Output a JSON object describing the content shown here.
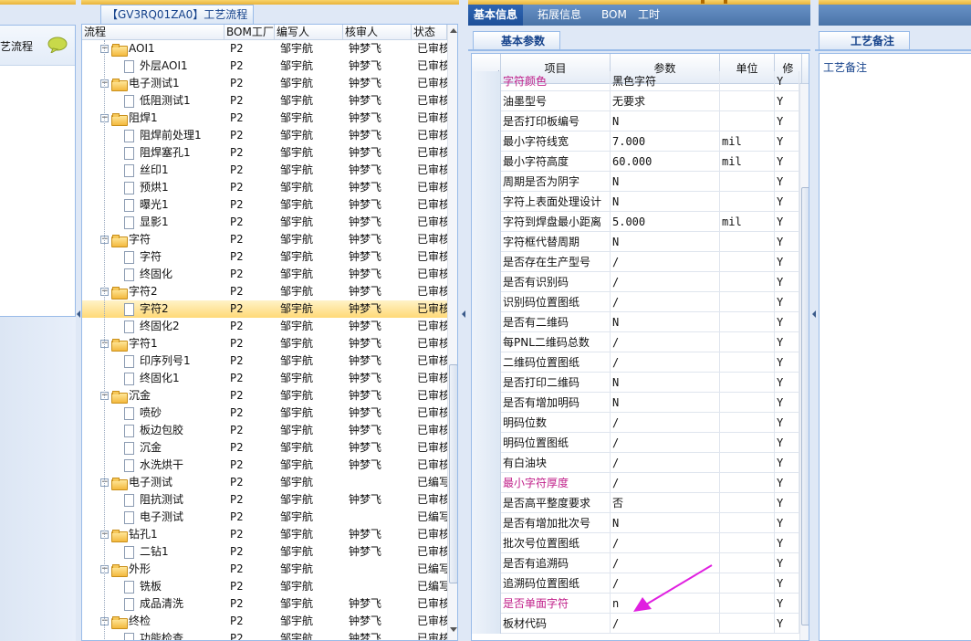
{
  "left_panel": {
    "label": "艺流程",
    "icon": "speech-bubble-icon"
  },
  "flow": {
    "title": "【GV3RQ01ZA0】工艺流程",
    "columns": [
      "流程",
      "BOM工厂",
      "编写人",
      "核审人",
      "状态"
    ],
    "rows": [
      {
        "name": "AOI1",
        "factory": "P2",
        "writer": "邹宇航",
        "reviewer": "钟梦飞",
        "status": "已审核"
      },
      {
        "name": "外层AOI1",
        "factory": "P2",
        "writer": "邹宇航",
        "reviewer": "钟梦飞",
        "status": "已审核"
      },
      {
        "name": "电子测试1",
        "factory": "P2",
        "writer": "邹宇航",
        "reviewer": "钟梦飞",
        "status": "已审核"
      },
      {
        "name": "低阻测试1",
        "factory": "P2",
        "writer": "邹宇航",
        "reviewer": "钟梦飞",
        "status": "已审核"
      },
      {
        "name": "阻焊1",
        "factory": "P2",
        "writer": "邹宇航",
        "reviewer": "钟梦飞",
        "status": "已审核"
      },
      {
        "name": "阻焊前处理1",
        "factory": "P2",
        "writer": "邹宇航",
        "reviewer": "钟梦飞",
        "status": "已审核"
      },
      {
        "name": "阻焊塞孔1",
        "factory": "P2",
        "writer": "邹宇航",
        "reviewer": "钟梦飞",
        "status": "已审核"
      },
      {
        "name": "丝印1",
        "factory": "P2",
        "writer": "邹宇航",
        "reviewer": "钟梦飞",
        "status": "已审核"
      },
      {
        "name": "预烘1",
        "factory": "P2",
        "writer": "邹宇航",
        "reviewer": "钟梦飞",
        "status": "已审核"
      },
      {
        "name": "曝光1",
        "factory": "P2",
        "writer": "邹宇航",
        "reviewer": "钟梦飞",
        "status": "已审核"
      },
      {
        "name": "显影1",
        "factory": "P2",
        "writer": "邹宇航",
        "reviewer": "钟梦飞",
        "status": "已审核"
      },
      {
        "name": "字符",
        "factory": "P2",
        "writer": "邹宇航",
        "reviewer": "钟梦飞",
        "status": "已审核"
      },
      {
        "name": "字符",
        "factory": "P2",
        "writer": "邹宇航",
        "reviewer": "钟梦飞",
        "status": "已审核"
      },
      {
        "name": "终固化",
        "factory": "P2",
        "writer": "邹宇航",
        "reviewer": "钟梦飞",
        "status": "已审核"
      },
      {
        "name": "字符2",
        "factory": "P2",
        "writer": "邹宇航",
        "reviewer": "钟梦飞",
        "status": "已审核"
      },
      {
        "name": "字符2",
        "factory": "P2",
        "writer": "邹宇航",
        "reviewer": "钟梦飞",
        "status": "已审核"
      },
      {
        "name": "终固化2",
        "factory": "P2",
        "writer": "邹宇航",
        "reviewer": "钟梦飞",
        "status": "已审核"
      },
      {
        "name": "字符1",
        "factory": "P2",
        "writer": "邹宇航",
        "reviewer": "钟梦飞",
        "status": "已审核"
      },
      {
        "name": "印序列号1",
        "factory": "P2",
        "writer": "邹宇航",
        "reviewer": "钟梦飞",
        "status": "已审核"
      },
      {
        "name": "终固化1",
        "factory": "P2",
        "writer": "邹宇航",
        "reviewer": "钟梦飞",
        "status": "已审核"
      },
      {
        "name": "沉金",
        "factory": "P2",
        "writer": "邹宇航",
        "reviewer": "钟梦飞",
        "status": "已审核"
      },
      {
        "name": "喷砂",
        "factory": "P2",
        "writer": "邹宇航",
        "reviewer": "钟梦飞",
        "status": "已审核"
      },
      {
        "name": "板边包胶",
        "factory": "P2",
        "writer": "邹宇航",
        "reviewer": "钟梦飞",
        "status": "已审核"
      },
      {
        "name": "沉金",
        "factory": "P2",
        "writer": "邹宇航",
        "reviewer": "钟梦飞",
        "status": "已审核"
      },
      {
        "name": "水洗烘干",
        "factory": "P2",
        "writer": "邹宇航",
        "reviewer": "钟梦飞",
        "status": "已审核"
      },
      {
        "name": "电子测试",
        "factory": "P2",
        "writer": "邹宇航",
        "reviewer": "",
        "status": "已编写"
      },
      {
        "name": "阻抗测试",
        "factory": "P2",
        "writer": "邹宇航",
        "reviewer": "钟梦飞",
        "status": "已审核"
      },
      {
        "name": "电子测试",
        "factory": "P2",
        "writer": "邹宇航",
        "reviewer": "",
        "status": "已编写"
      },
      {
        "name": "钻孔1",
        "factory": "P2",
        "writer": "邹宇航",
        "reviewer": "钟梦飞",
        "status": "已审核"
      },
      {
        "name": "二钻1",
        "factory": "P2",
        "writer": "邹宇航",
        "reviewer": "钟梦飞",
        "status": "已审核"
      },
      {
        "name": "外形",
        "factory": "P2",
        "writer": "邹宇航",
        "reviewer": "",
        "status": "已编写"
      },
      {
        "name": "铣板",
        "factory": "P2",
        "writer": "邹宇航",
        "reviewer": "",
        "status": "已编写"
      },
      {
        "name": "成品清洗",
        "factory": "P2",
        "writer": "邹宇航",
        "reviewer": "钟梦飞",
        "status": "已审核"
      },
      {
        "name": "终检",
        "factory": "P2",
        "writer": "邹宇航",
        "reviewer": "钟梦飞",
        "status": "已审核"
      },
      {
        "name": "功能检查",
        "factory": "P2",
        "writer": "邹宇航",
        "reviewer": "钟梦飞",
        "status": "已审核"
      }
    ]
  },
  "tabs": [
    "基本信息",
    "拓展信息",
    "BOM",
    "工时"
  ],
  "active_tab": "基本信息",
  "sub_tab": "基本参数",
  "params": {
    "columns": [
      "项目",
      "参数",
      "单位",
      "修"
    ],
    "rows": [
      {
        "item": "字符颜色",
        "value": "黑色字符",
        "unit": "",
        "flag": "Y",
        "pink": true
      },
      {
        "item": "油墨型号",
        "value": "无要求",
        "unit": "",
        "flag": "Y"
      },
      {
        "item": "是否打印板编号",
        "value": "N",
        "unit": "",
        "flag": "Y"
      },
      {
        "item": "最小字符线宽",
        "value": "7.000",
        "unit": "mil",
        "flag": "Y"
      },
      {
        "item": "最小字符高度",
        "value": "60.000",
        "unit": "mil",
        "flag": "Y"
      },
      {
        "item": "周期是否为阴字",
        "value": "N",
        "unit": "",
        "flag": "Y"
      },
      {
        "item": "字符上表面处理设计",
        "value": "N",
        "unit": "",
        "flag": "Y"
      },
      {
        "item": "字符到焊盘最小距离",
        "value": "5.000",
        "unit": "mil",
        "flag": "Y"
      },
      {
        "item": "字符框代替周期",
        "value": "N",
        "unit": "",
        "flag": "Y"
      },
      {
        "item": "是否存在生产型号",
        "value": "/",
        "unit": "",
        "flag": "Y"
      },
      {
        "item": "是否有识别码",
        "value": "/",
        "unit": "",
        "flag": "Y"
      },
      {
        "item": "识别码位置图纸",
        "value": "/",
        "unit": "",
        "flag": "Y"
      },
      {
        "item": "是否有二维码",
        "value": "N",
        "unit": "",
        "flag": "Y"
      },
      {
        "item": "每PNL二维码总数",
        "value": "/",
        "unit": "",
        "flag": "Y"
      },
      {
        "item": "二维码位置图纸",
        "value": "/",
        "unit": "",
        "flag": "Y"
      },
      {
        "item": "是否打印二维码",
        "value": "N",
        "unit": "",
        "flag": "Y"
      },
      {
        "item": "是否有增加明码",
        "value": "N",
        "unit": "",
        "flag": "Y"
      },
      {
        "item": "明码位数",
        "value": "/",
        "unit": "",
        "flag": "Y"
      },
      {
        "item": "明码位置图纸",
        "value": "/",
        "unit": "",
        "flag": "Y"
      },
      {
        "item": "有白油块",
        "value": "/",
        "unit": "",
        "flag": "Y"
      },
      {
        "item": "最小字符厚度",
        "value": "/",
        "unit": "",
        "flag": "Y",
        "pink": true
      },
      {
        "item": "是否高平整度要求",
        "value": "否",
        "unit": "",
        "flag": "Y"
      },
      {
        "item": "是否有增加批次号",
        "value": "N",
        "unit": "",
        "flag": "Y"
      },
      {
        "item": "批次号位置图纸",
        "value": "/",
        "unit": "",
        "flag": "Y"
      },
      {
        "item": "是否有追溯码",
        "value": "/",
        "unit": "",
        "flag": "Y"
      },
      {
        "item": "追溯码位置图纸",
        "value": "/",
        "unit": "",
        "flag": "Y"
      },
      {
        "item": "是否单面字符",
        "value": "n",
        "unit": "",
        "flag": "Y",
        "pink": true
      },
      {
        "item": "板材代码",
        "value": "/",
        "unit": "",
        "flag": "Y"
      }
    ]
  },
  "notes": {
    "tab": "工艺备注",
    "label": "工艺备注"
  },
  "colors": {
    "accent": "#15428b",
    "highlight_pink": "#c0208a",
    "arrow": "#e020e0",
    "tab_active": "#1d4f98",
    "folder": "#f3b93e"
  }
}
